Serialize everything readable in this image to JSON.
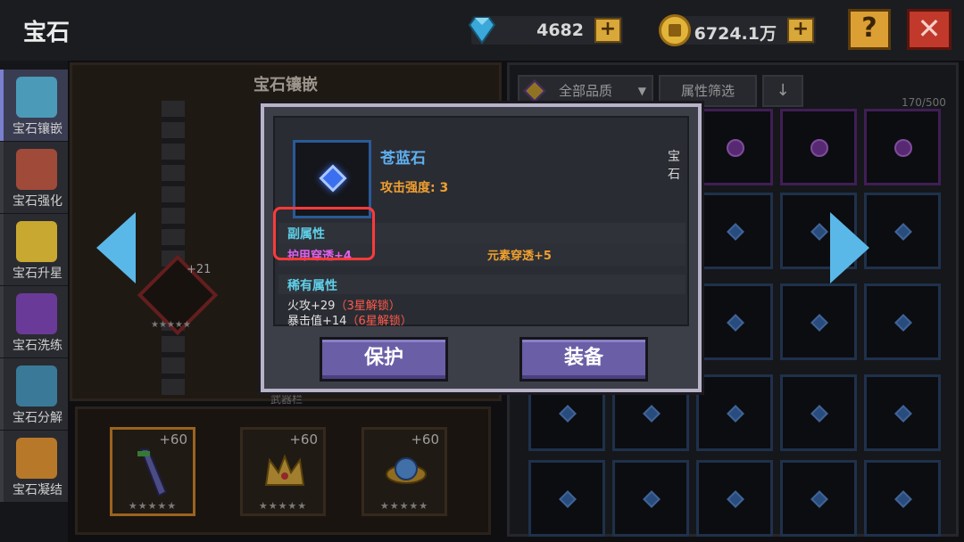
{
  "header": {
    "title": "宝石",
    "diamonds": "4682",
    "gold": "6724.1万",
    "plus_label": "+",
    "help_label": "?",
    "close_label": "✕"
  },
  "side_tabs": [
    {
      "label": "宝石镶嵌",
      "active": true
    },
    {
      "label": "宝石强化",
      "active": false
    },
    {
      "label": "宝石升星",
      "active": false
    },
    {
      "label": "宝石洗练",
      "active": false
    },
    {
      "label": "宝石分解",
      "active": false
    },
    {
      "label": "宝石凝结",
      "active": false
    }
  ],
  "left_panel": {
    "title": "宝石镶嵌",
    "left_slot_level": "+21",
    "left_slot_stars": "★★★★★",
    "weapon_label": "武器栏"
  },
  "equipment_slots": [
    {
      "level": "+60",
      "stars": "★★★★★",
      "icon": "sword-icon"
    },
    {
      "level": "+60",
      "stars": "★★★★★",
      "icon": "crown-icon"
    },
    {
      "level": "+60",
      "stars": "★★★★★",
      "icon": "orb-icon"
    }
  ],
  "inventory": {
    "quality_filter": "全部品质",
    "attr_filter": "属性筛选",
    "sort_icon": "down-arrow-icon",
    "count": "170/500"
  },
  "dialog": {
    "gem_name": "苍蓝石",
    "gem_type": "宝石",
    "main_attr": "攻击强度: 3",
    "sub_title": "副属性",
    "sub_attrs": [
      "护甲穿透+4",
      "元素穿透+5"
    ],
    "rare_title": "稀有属性",
    "rare_attrs": [
      {
        "text": "火攻+29",
        "lock": "（3星解锁）"
      },
      {
        "text": "暴击值+14",
        "lock": "（6星解锁）"
      }
    ],
    "protect_label": "保护",
    "equip_label": "装备"
  },
  "colors": {
    "accent_blue": "#5fb0f0",
    "attr_orange": "#f0a030",
    "sub_purple": "#e060f0",
    "highlight_red": "#ff3a3a",
    "button_purple": "#6a5fa6"
  }
}
